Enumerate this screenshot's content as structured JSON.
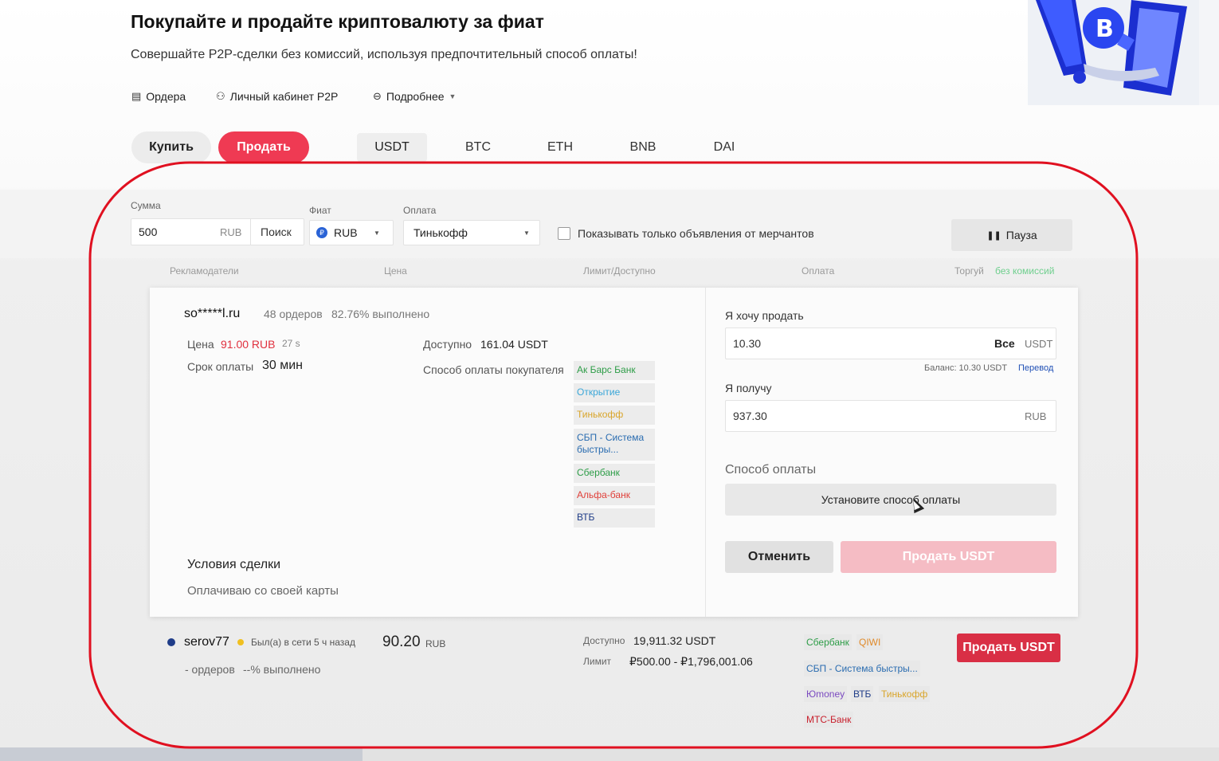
{
  "header": {
    "title": "Покупайте и продайте криптовалюту за фиат",
    "subtitle": "Совершайте P2P-сделки без комиссий, используя предпочтительный способ оплаты!"
  },
  "nav": [
    {
      "label": "Ордера",
      "icon": "orders-icon"
    },
    {
      "label": "Личный кабинет P2P",
      "icon": "profile-icon"
    },
    {
      "label": "Подробнее",
      "icon": "more-icon"
    }
  ],
  "mode": {
    "buy": "Купить",
    "sell": "Продать",
    "active": "sell"
  },
  "coins": [
    "USDT",
    "BTC",
    "ETH",
    "BNB",
    "DAI"
  ],
  "filters": {
    "amount_label": "Сумма",
    "amount_value": "500",
    "amount_currency": "RUB",
    "search": "Поиск",
    "fiat_label": "Фиат",
    "fiat_value": "RUB",
    "payment_label": "Оплата",
    "payment_value": "Тинькофф",
    "merchants_only": "Показывать только объявления от мерчантов",
    "pause": "Пауза"
  },
  "columns": {
    "advertisers": "Рекламодатели",
    "price": "Цена",
    "limit": "Лимит/Доступно",
    "payment": "Оплата",
    "trade": "Торгуй",
    "no_fee": "без комиссий"
  },
  "expanded": {
    "name": "so*****l.ru",
    "orders": "48 ордеров",
    "completion": "82.76% выполнено",
    "price_label": "Цена",
    "price_value": "91.00 RUB",
    "price_timer": "27 s",
    "term_label": "Срок оплаты",
    "term_value": "30 мин",
    "available_label": "Доступно",
    "available_value": "161.04 USDT",
    "buyer_methods_label": "Способ оплаты покупателя",
    "methods": [
      {
        "label": "Ак Барс Банк",
        "color": "#2e9d48"
      },
      {
        "label": "Открытие",
        "color": "#3aa6d8"
      },
      {
        "label": "Тинькофф",
        "color": "#d9a52a"
      },
      {
        "label": "СБП - Система быстры...",
        "color": "#2a6cb0"
      },
      {
        "label": "Сбербанк",
        "color": "#2e9d48"
      },
      {
        "label": "Альфа-банк",
        "color": "#e0403a"
      },
      {
        "label": "ВТБ",
        "color": "#1f3c88"
      }
    ],
    "terms_title": "Условия сделки",
    "terms_text": "Оплачиваю со своей карты"
  },
  "sell_form": {
    "want_label": "Я хочу продать",
    "want_value": "10.30",
    "all": "Все",
    "want_currency": "USDT",
    "balance": "Баланс: 10.30 USDT",
    "transfer": "Перевод",
    "receive_label": "Я получу",
    "receive_value": "937.30",
    "receive_currency": "RUB",
    "payment_label": "Способ оплаты",
    "set_payment": "Установите способ оплаты",
    "cancel": "Отменить",
    "submit": "Продать USDT"
  },
  "row2": {
    "name": "serov77",
    "online": "Был(а) в сети 5 ч назад",
    "orders": "- ордеров",
    "completion": "--% выполнено",
    "price": "90.20",
    "price_currency": "RUB",
    "available_label": "Доступно",
    "available_value": "19,911.32 USDT",
    "limit_label": "Лимит",
    "limit_value": "₽500.00 - ₽1,796,001.06",
    "tags": [
      {
        "label": "Сбербанк",
        "color": "#2e9d48"
      },
      {
        "label": "QIWI",
        "color": "#e08a2a"
      },
      {
        "label": "СБП - Система быстры...",
        "color": "#2a6cb0"
      },
      {
        "label": "Юmoney",
        "color": "#7b4ac0"
      },
      {
        "label": "ВТБ",
        "color": "#1f3c88"
      },
      {
        "label": "Тинькофф",
        "color": "#d9a52a"
      },
      {
        "label": "МТС-Банк",
        "color": "#c8202d"
      }
    ],
    "action": "Продать USDT"
  },
  "colors": {
    "accent": "#ef3a53",
    "annotation": "#e01020"
  }
}
